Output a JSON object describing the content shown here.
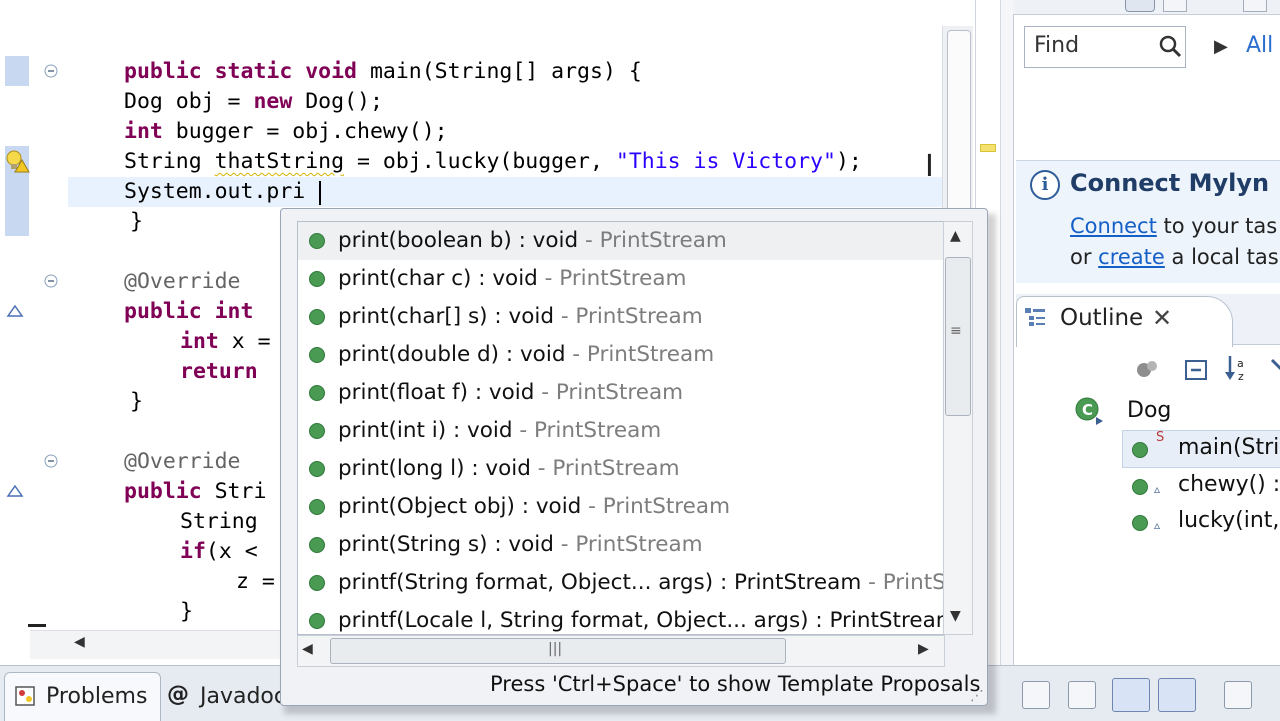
{
  "editor": {
    "lines": [
      {
        "parts": [
          {
            "t": "public static void ",
            "c": "kw"
          },
          {
            "t": "main(String[] args) {"
          }
        ]
      },
      {
        "parts": [
          {
            "t": "Dog obj = "
          },
          {
            "t": "new ",
            "c": "kw"
          },
          {
            "t": "Dog();"
          }
        ]
      },
      {
        "parts": [
          {
            "t": "int ",
            "c": "kw"
          },
          {
            "t": "bugger = obj.chewy();"
          }
        ]
      },
      {
        "parts": [
          {
            "t": "String "
          },
          {
            "t": "thatString",
            "c": "squig"
          },
          {
            "t": " = obj.lucky(bugger, "
          },
          {
            "t": "\"This is Victory\"",
            "c": "str"
          },
          {
            "t": ");"
          }
        ]
      },
      {
        "parts": [
          {
            "t": "System.out.pri"
          }
        ]
      },
      {
        "parts": [
          {
            "t": "}"
          }
        ]
      },
      {
        "parts": []
      },
      {
        "parts": [
          {
            "t": "@Override",
            "c": "ann"
          }
        ]
      },
      {
        "parts": [
          {
            "t": "public int",
            "c": "kw"
          }
        ]
      },
      {
        "parts": [
          {
            "t": "int ",
            "c": "kw"
          },
          {
            "t": "x ="
          }
        ]
      },
      {
        "parts": [
          {
            "t": "return",
            "c": "kw"
          }
        ]
      },
      {
        "parts": [
          {
            "t": "}"
          }
        ]
      },
      {
        "parts": []
      },
      {
        "parts": [
          {
            "t": "@Override",
            "c": "ann"
          }
        ]
      },
      {
        "parts": [
          {
            "t": "public ",
            "c": "kw"
          },
          {
            "t": "Stri"
          }
        ]
      },
      {
        "parts": [
          {
            "t": "String"
          }
        ]
      },
      {
        "parts": [
          {
            "t": "if",
            "c": "kw"
          },
          {
            "t": "(x <"
          }
        ]
      },
      {
        "parts": [
          {
            "t": "z ="
          }
        ]
      },
      {
        "parts": [
          {
            "t": "}"
          }
        ]
      }
    ],
    "indents": [
      124,
      124,
      124,
      124,
      124,
      130,
      0,
      124,
      124,
      180,
      180,
      130,
      0,
      124,
      124,
      180,
      180,
      236,
      180
    ]
  },
  "content_assist": {
    "proposals": [
      {
        "sig": "print(boolean b) : void",
        "type": " - PrintStream"
      },
      {
        "sig": "print(char c) : void",
        "type": " - PrintStream"
      },
      {
        "sig": "print(char[] s) : void",
        "type": " - PrintStream"
      },
      {
        "sig": "print(double d) : void",
        "type": " - PrintStream"
      },
      {
        "sig": "print(float f) : void",
        "type": " - PrintStream"
      },
      {
        "sig": "print(int i) : void",
        "type": " - PrintStream"
      },
      {
        "sig": "print(long l) : void",
        "type": " - PrintStream"
      },
      {
        "sig": "print(Object obj) : void",
        "type": " - PrintStream"
      },
      {
        "sig": "print(String s) : void",
        "type": " - PrintStream"
      },
      {
        "sig": "printf(String format, Object... args) : PrintStream",
        "type": " - PrintStr"
      },
      {
        "sig": "printf(Locale l, String format, Object... args) : PrintStream",
        "type": ""
      }
    ],
    "status": "Press 'Ctrl+Space' to show Template Proposals"
  },
  "task_list": {
    "find_placeholder": "Find",
    "all_label": "All"
  },
  "mylyn": {
    "title": "Connect Mylyn",
    "connect_link": "Connect",
    "line1_rest": " to your tas",
    "line2_pre": "or ",
    "create_link": "create",
    "line2_rest": " a local task"
  },
  "outline": {
    "tab_label": "Outline",
    "class_name": "Dog",
    "members": [
      "main(Strin",
      "chewy() :",
      "lucky(int,"
    ]
  },
  "bottom_tabs": {
    "problems": "Problems",
    "javadoc": "Javadoc"
  },
  "colors": {
    "keyword": "#7f0055",
    "string": "#2a00ff",
    "method_icon": "#4a9a54"
  }
}
